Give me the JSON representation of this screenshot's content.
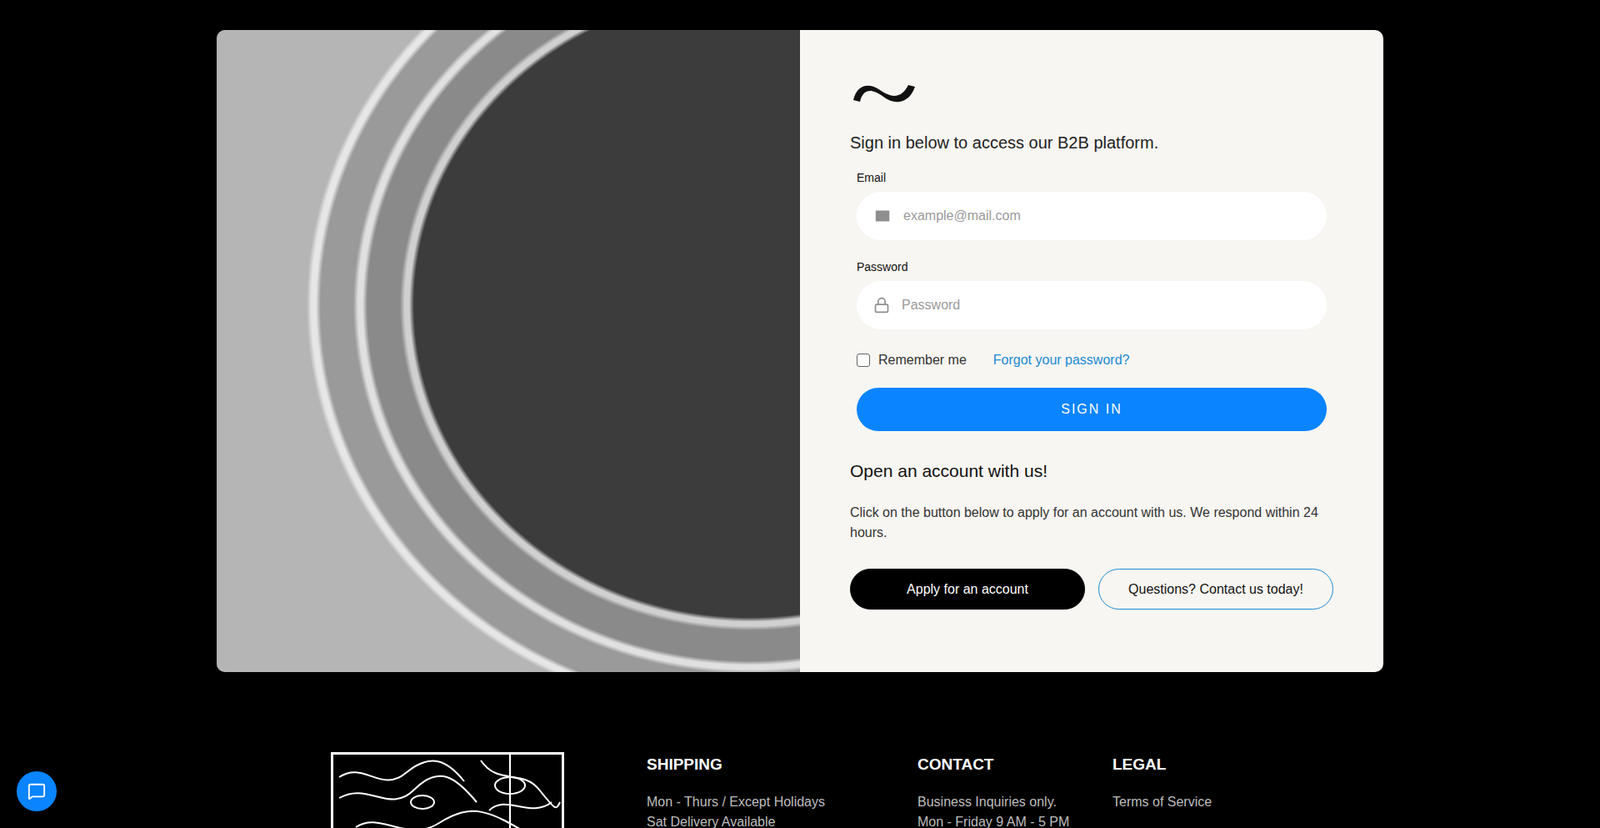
{
  "login": {
    "subtitle": "Sign in below to access our B2B platform.",
    "fields": [
      {
        "label": "Email",
        "placeholder": "example@mail.com",
        "kind": "email"
      },
      {
        "label": "Password",
        "placeholder": "Password",
        "kind": "password"
      }
    ],
    "remember": {
      "label": "Remember me",
      "checked": false
    },
    "forgot": "Forgot your password?",
    "submit": "SIGN IN"
  },
  "signup": {
    "title": "Open an account with us!",
    "text": "Click on the button below to apply for an account with us. We respond within 24 hours.",
    "buttons": [
      {
        "label": "Apply for an account",
        "kind": "primary"
      },
      {
        "label": "Questions? Contact us today!",
        "kind": "outline"
      }
    ]
  },
  "footer": {
    "columns": [
      {
        "title": "SHIPPING",
        "lines": [
          "Mon - Thurs / Except Holidays",
          "Sat Delivery Available"
        ]
      },
      {
        "title": "CONTACT",
        "lines": [
          "Business Inquiries only.",
          "Mon - Friday 9 AM - 5 PM"
        ]
      },
      {
        "title": "LEGAL",
        "lines": [
          "Terms of Service"
        ]
      }
    ]
  }
}
